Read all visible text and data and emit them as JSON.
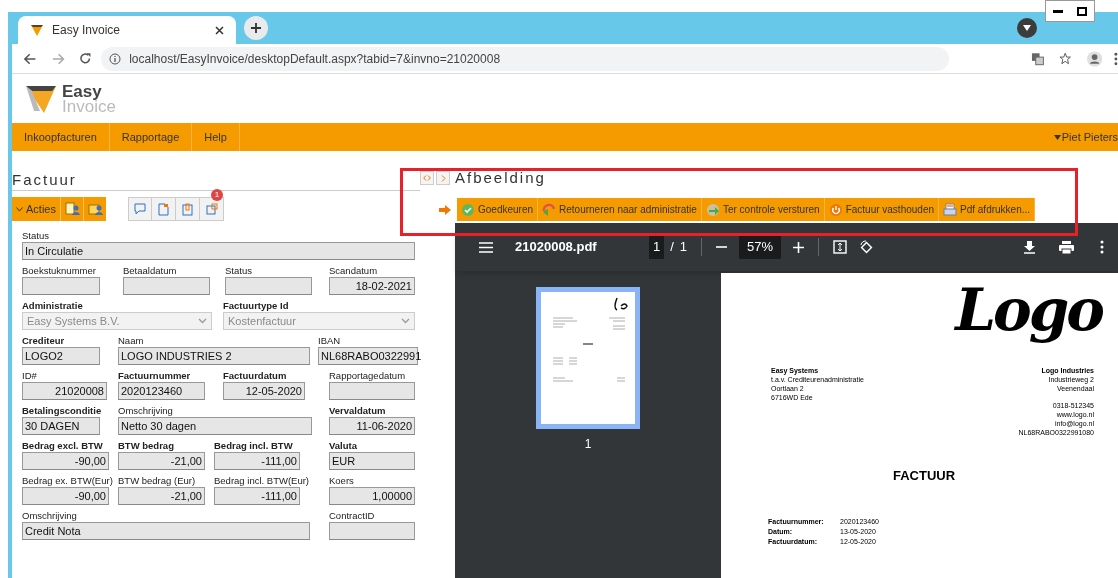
{
  "browser": {
    "tab_title": "Easy Invoice",
    "url": "localhost/EasyInvoice/desktopDefault.aspx?tabid=7&invno=21020008"
  },
  "app": {
    "logo_line1": "Easy",
    "logo_line2": "Invoice"
  },
  "menu": {
    "items": [
      "Inkoopfacturen",
      "Rapportage",
      "Help"
    ],
    "user": "Piet Pieters"
  },
  "left": {
    "title": "Factuur",
    "actions_label": "Acties",
    "notification_count": "1",
    "rows": [
      [
        {
          "label": "Status",
          "value": "In Circulatie",
          "kind": "text",
          "required": false
        }
      ],
      [
        {
          "label": "Boekstuknummer",
          "kind": "text",
          "required": false
        },
        {
          "label": "Betaaldatum",
          "kind": "text",
          "required": false
        },
        {
          "label": "Status",
          "kind": "text",
          "required": false
        },
        {
          "label": "Scandatum",
          "value": "18-02-2021",
          "kind": "text",
          "required": false
        }
      ],
      [
        {
          "label": "Administratie",
          "value": "Easy Systems B.V.",
          "kind": "select",
          "required": true
        },
        {
          "label": "Factuurtype Id",
          "value": "Kostenfactuur",
          "kind": "select",
          "required": true
        }
      ],
      [
        {
          "label": "Crediteur",
          "value": "LOGO2",
          "kind": "text",
          "required": true
        },
        {
          "label": "Naam",
          "value": "LOGO INDUSTRIES 2",
          "kind": "text",
          "required": false
        },
        {
          "label": "IBAN",
          "value": "NL68RABO0322991",
          "kind": "text",
          "required": false
        }
      ],
      [
        {
          "label": "ID#",
          "value": "21020008",
          "kind": "text",
          "required": false
        },
        {
          "label": "Factuurnummer",
          "value": "2020123460",
          "kind": "text",
          "required": true
        },
        {
          "label": "Factuurdatum",
          "value": "12-05-2020",
          "kind": "text",
          "required": true
        },
        {
          "label": "Rapportagedatum",
          "kind": "text",
          "required": false
        }
      ],
      [
        {
          "label": "Betalingsconditie",
          "value": "30 DAGEN",
          "kind": "text",
          "required": true
        },
        {
          "label": "Omschrijving",
          "value": "Netto 30 dagen",
          "kind": "text",
          "required": false
        },
        {
          "label": "Vervaldatum",
          "value": "11-06-2020",
          "kind": "text",
          "required": true
        }
      ],
      [
        {
          "label": "Bedrag excl. BTW",
          "value": "-90,00",
          "kind": "text",
          "required": true
        },
        {
          "label": "BTW bedrag",
          "value": "-21,00",
          "kind": "text",
          "required": true
        },
        {
          "label": "Bedrag incl. BTW",
          "value": "-111,00",
          "kind": "text",
          "required": true
        },
        {
          "label": "Valuta",
          "value": "EUR",
          "kind": "text",
          "required": true
        }
      ],
      [
        {
          "label": "Bedrag ex. BTW(Eur)",
          "value": "-90,00",
          "kind": "text",
          "required": false
        },
        {
          "label": "BTW bedrag (Eur)",
          "value": "-21,00",
          "kind": "text",
          "required": false
        },
        {
          "label": "Bedrag incl. BTW(Eur)",
          "value": "-111,00",
          "kind": "text",
          "required": false
        },
        {
          "label": "Koers",
          "value": "1,00000",
          "kind": "text",
          "required": false
        }
      ],
      [
        {
          "label": "Omschrijving",
          "value": "Credit Nota",
          "kind": "text",
          "required": false
        },
        null,
        null,
        {
          "label": "ContractID",
          "kind": "text",
          "required": false
        }
      ]
    ]
  },
  "right": {
    "title": "Afbeelding",
    "actions": [
      {
        "label": "Goedkeuren",
        "kind": "approve"
      },
      {
        "label": "Retourneren naar administratie",
        "kind": "return"
      },
      {
        "label": "Ter controle versturen",
        "kind": "send"
      },
      {
        "label": "Factuur vasthouden",
        "kind": "hold"
      },
      {
        "label": "Pdf afdrukken...",
        "kind": "print"
      }
    ],
    "pdf": {
      "filename": "21020008.pdf",
      "page": "1",
      "separator": "/",
      "page_count": "1",
      "zoom": "57%",
      "thumbnail_label": "1",
      "document": {
        "logo": "Logo",
        "sender": [
          "Easy Systems",
          "t.a.v. Crediteurenadministratie",
          "Oortlaan 2",
          "6716WD Ede"
        ],
        "supplier": [
          "Logo Industries",
          "Industrieweg 2",
          "Veenendaal",
          "0318-512345",
          "www.logo.nl",
          "info@logo.nl",
          "NL68RABO0322991080"
        ],
        "title": "FACTUUR",
        "details": [
          {
            "label": "Factuurnummer:",
            "value": "2020123460"
          },
          {
            "label": "Datum:",
            "value": "13-05-2020"
          },
          {
            "label": "Factuurdatum:",
            "value": "12-05-2020"
          }
        ]
      }
    }
  }
}
